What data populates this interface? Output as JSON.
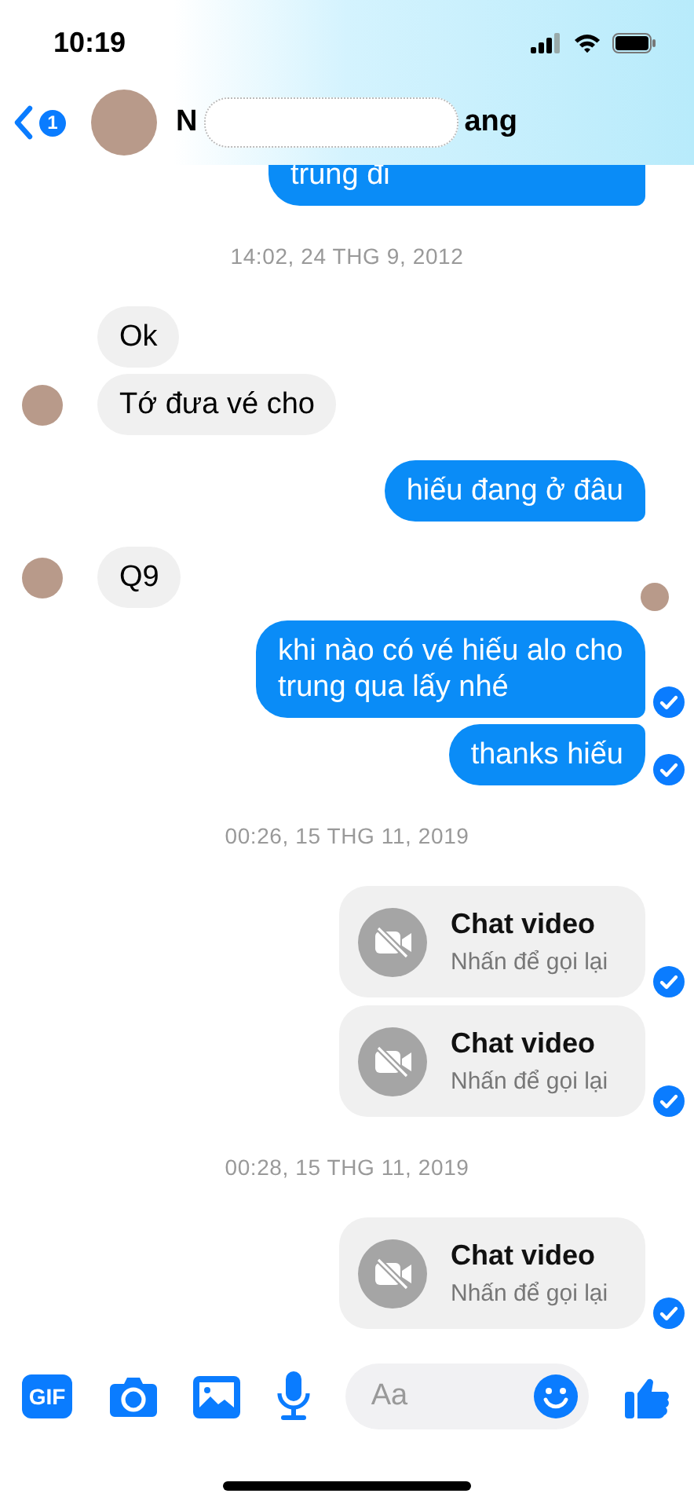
{
  "status_bar": {
    "time": "10:19"
  },
  "header": {
    "back_badge": "1",
    "title_start": "N",
    "title_end": "ang",
    "redacted": true
  },
  "messages": [
    {
      "kind": "outgoing",
      "text": "trung đi",
      "delivered": false
    },
    {
      "kind": "timestamp",
      "text": "14:02, 24 THG 9, 2012"
    },
    {
      "kind": "incoming",
      "text": "Ok",
      "avatar": false
    },
    {
      "kind": "incoming",
      "text": "Tớ đưa vé cho",
      "avatar": true
    },
    {
      "kind": "outgoing",
      "text": "hiếu đang ở đâu",
      "delivered": false
    },
    {
      "kind": "incoming",
      "text": "Q9",
      "avatar": true
    },
    {
      "kind": "seen"
    },
    {
      "kind": "outgoing",
      "text": "khi nào có vé hiếu alo cho trung qua lấy nhé",
      "delivered": true
    },
    {
      "kind": "outgoing",
      "text": "thanks hiếu",
      "delivered": true
    },
    {
      "kind": "timestamp",
      "text": "00:26, 15 THG 11, 2019"
    },
    {
      "kind": "call",
      "title": "Chat video",
      "subtitle": "Nhấn để gọi lại",
      "delivered": true
    },
    {
      "kind": "call",
      "title": "Chat video",
      "subtitle": "Nhấn để gọi lại",
      "delivered": true
    },
    {
      "kind": "timestamp",
      "text": "00:28, 15 THG 11, 2019"
    },
    {
      "kind": "call",
      "title": "Chat video",
      "subtitle": "Nhấn để gọi lại",
      "delivered": true
    }
  ],
  "composer": {
    "gif_label": "GIF",
    "placeholder": "Aa"
  }
}
